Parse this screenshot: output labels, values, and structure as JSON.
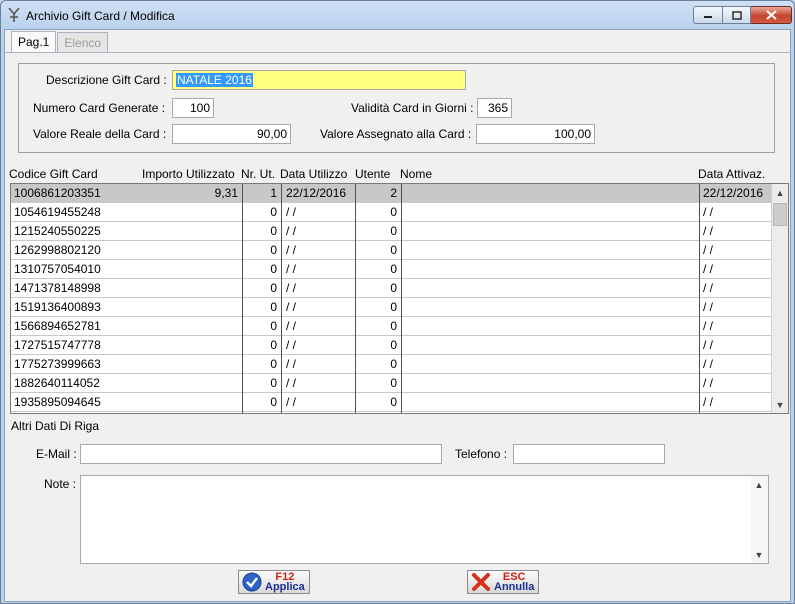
{
  "window": {
    "title": "Archivio Gift Card / Modifica"
  },
  "tabs": [
    {
      "label": "Pag.1",
      "active": true
    },
    {
      "label": "Elenco",
      "active": false
    }
  ],
  "form": {
    "descrizione_label": "Descrizione Gift Card :",
    "descrizione_value": "NATALE 2016",
    "numero_label": "Numero Card Generate :",
    "numero_value": "100",
    "validita_label": "Validità Card in Giorni :",
    "validita_value": "365",
    "valore_reale_label": "Valore Reale della Card :",
    "valore_reale_value": "90,00",
    "valore_assegnato_label": "Valore Assegnato alla Card :",
    "valore_assegnato_value": "100,00"
  },
  "grid": {
    "columns": {
      "codice": "Codice Gift Card",
      "importo": "Importo Utilizzato",
      "nr_ut": "Nr. Ut.",
      "data_utilizzo": "Data Utilizzo",
      "utente": "Utente",
      "nome": "Nome",
      "data_attivaz": "Data Attivaz."
    },
    "rows": [
      {
        "codice": "1006861203351",
        "importo": "9,31",
        "nr": "1",
        "data": "22/12/2016",
        "utente": "2",
        "nome": "",
        "attiv": "22/12/2016"
      },
      {
        "codice": "1054619455248",
        "importo": "",
        "nr": "0",
        "data": " / /",
        "utente": "0",
        "nome": "",
        "attiv": " / /"
      },
      {
        "codice": "1215240550225",
        "importo": "",
        "nr": "0",
        "data": " / /",
        "utente": "0",
        "nome": "",
        "attiv": " / /"
      },
      {
        "codice": "1262998802120",
        "importo": "",
        "nr": "0",
        "data": " / /",
        "utente": "0",
        "nome": "",
        "attiv": " / /"
      },
      {
        "codice": "1310757054010",
        "importo": "",
        "nr": "0",
        "data": " / /",
        "utente": "0",
        "nome": "",
        "attiv": " / /"
      },
      {
        "codice": "1471378148998",
        "importo": "",
        "nr": "0",
        "data": " / /",
        "utente": "0",
        "nome": "",
        "attiv": " / /"
      },
      {
        "codice": "1519136400893",
        "importo": "",
        "nr": "0",
        "data": " / /",
        "utente": "0",
        "nome": "",
        "attiv": " / /"
      },
      {
        "codice": "1566894652781",
        "importo": "",
        "nr": "0",
        "data": " / /",
        "utente": "0",
        "nome": "",
        "attiv": " / /"
      },
      {
        "codice": "1727515747778",
        "importo": "",
        "nr": "0",
        "data": " / /",
        "utente": "0",
        "nome": "",
        "attiv": " / /"
      },
      {
        "codice": "1775273999663",
        "importo": "",
        "nr": "0",
        "data": " / /",
        "utente": "0",
        "nome": "",
        "attiv": " / /"
      },
      {
        "codice": "1882640114052",
        "importo": "",
        "nr": "0",
        "data": " / /",
        "utente": "0",
        "nome": "",
        "attiv": " / /"
      },
      {
        "codice": "1935895094645",
        "importo": "",
        "nr": "0",
        "data": " / /",
        "utente": "0",
        "nome": "",
        "attiv": " / /"
      }
    ]
  },
  "details": {
    "section_title": "Altri Dati Di Riga",
    "email_label": "E-Mail :",
    "email_value": "",
    "telefono_label": "Telefono :",
    "telefono_value": "",
    "note_label": "Note :",
    "note_value": ""
  },
  "buttons": {
    "apply_key": "F12",
    "apply_label": "Applica",
    "cancel_key": "ESC",
    "cancel_label": "Annulla"
  },
  "colors": {
    "selection": "#3399ff",
    "highlight_field": "#ffff80",
    "selected_row": "#c8c8c8",
    "button_key": "#d02010",
    "button_label": "#1c2f8f"
  }
}
